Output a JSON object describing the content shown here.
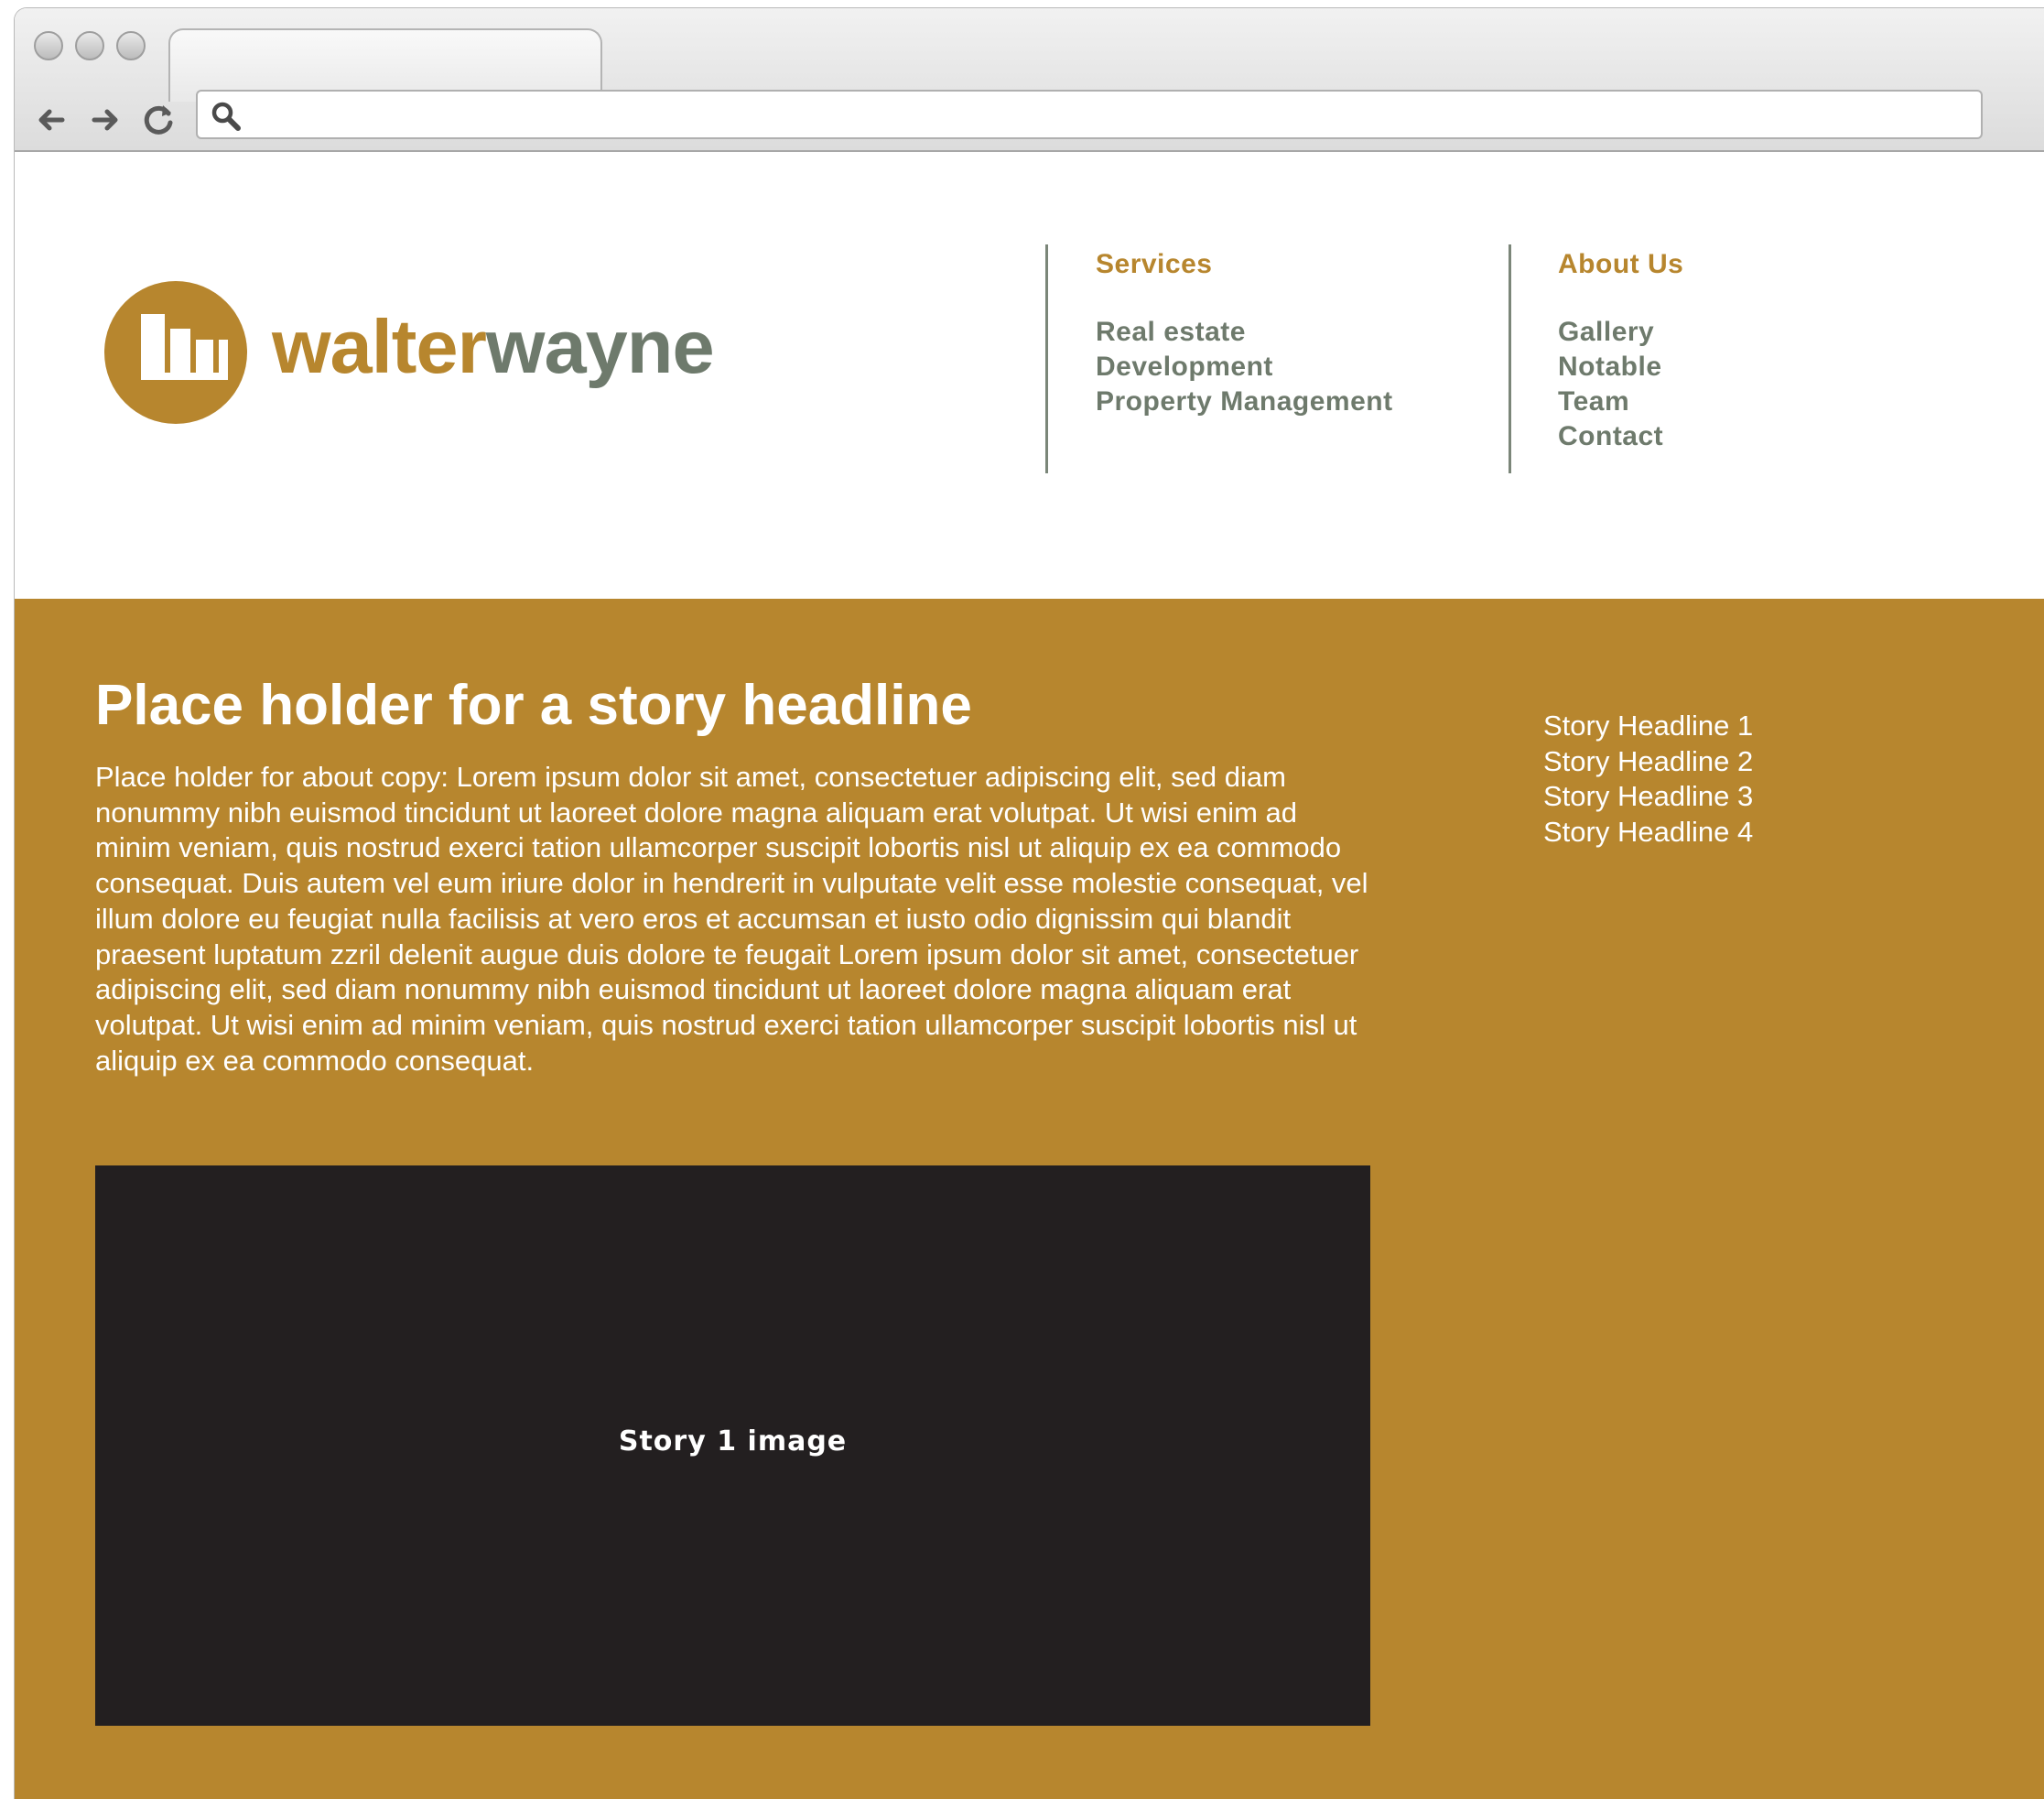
{
  "browser": {
    "address_value": "",
    "address_placeholder": "",
    "icons": {
      "back": "arrow-left-icon",
      "forward": "arrow-right-icon",
      "reload": "reload-icon",
      "search": "search-icon"
    },
    "colors": {
      "chrome": "#dcdcdc",
      "address_bg": "#ffffff"
    }
  },
  "header": {
    "brand_part1": "walter",
    "brand_part2": "wayne",
    "logo_icon": "building-bars-logo-icon",
    "nav": {
      "services": {
        "heading": "Services",
        "items": [
          "Real estate",
          "Development",
          "Property Management"
        ]
      },
      "about": {
        "heading": "About Us",
        "items": [
          "Gallery",
          "Notable",
          "Team",
          "Contact"
        ]
      }
    }
  },
  "main": {
    "headline": "Place holder for a story headline",
    "about_copy": "Place holder for about copy: Lorem ipsum dolor sit amet, consectetuer adipiscing elit, sed diam nonummy nibh euismod tincidunt ut laoreet dolore magna aliquam erat volutpat.  Ut wisi enim ad minim veniam, quis nostrud exerci tation ullamcorper suscipit lobortis nisl ut aliquip ex ea commodo consequat.  Duis autem vel eum iriure dolor in hendrerit in vulputate velit esse molestie consequat, vel illum dolore eu feugiat nulla facilisis at vero eros et accumsan et iusto odio dignissim qui blandit praesent luptatum zzril delenit augue duis dolore te feugait Lorem ipsum dolor sit amet, consectetuer adipiscing elit, sed diam nonummy nibh euismod tincidunt ut laoreet dolore magna aliquam erat volutpat.  Ut wisi enim ad minim veniam, quis nostrud exerci tation ullamcorper suscipit lobortis nisl ut aliquip ex ea commodo consequat.",
    "story_image_label": "Story 1 image",
    "stories": [
      "Story Headline 1",
      "Story Headline 2",
      "Story Headline 3",
      "Story Headline 4"
    ]
  },
  "colors": {
    "brand_gold": "#b7862e",
    "brand_gray": "#6e7a6c",
    "image_placeholder": "#231f20",
    "text_on_gold": "#ffffff"
  }
}
